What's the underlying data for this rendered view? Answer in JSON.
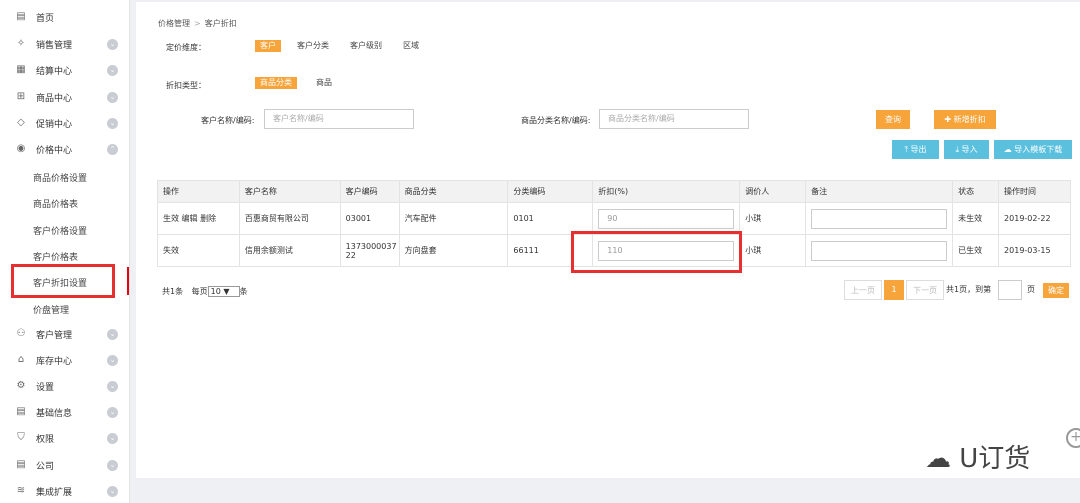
{
  "sidebar": {
    "items": [
      {
        "label": "首页",
        "icon": "doc-icon",
        "has_chevron": false
      },
      {
        "label": "销售管理",
        "icon": "sales-icon",
        "has_chevron": true
      },
      {
        "label": "结算中心",
        "icon": "settle-icon",
        "has_chevron": true
      },
      {
        "label": "商品中心",
        "icon": "grid-icon",
        "has_chevron": true
      },
      {
        "label": "促销中心",
        "icon": "tag-icon",
        "has_chevron": true
      },
      {
        "label": "价格中心",
        "icon": "price-icon",
        "has_chevron": true
      }
    ],
    "sub_items": [
      "商品价格设置",
      "商品价格表",
      "客户价格设置",
      "客户价格表",
      "客户折扣设置",
      "价盘管理"
    ],
    "lower_items": [
      {
        "label": "客户管理",
        "icon": "users-icon"
      },
      {
        "label": "库存中心",
        "icon": "warehouse-icon"
      },
      {
        "label": "设置",
        "icon": "gear-icon"
      },
      {
        "label": "基础信息",
        "icon": "info-icon"
      },
      {
        "label": "权限",
        "icon": "shield-icon"
      },
      {
        "label": "公司",
        "icon": "company-icon"
      },
      {
        "label": "集成扩展",
        "icon": "layers-icon"
      }
    ]
  },
  "breadcrumb": {
    "root": "价格管理",
    "sep": ">",
    "current": "客户折扣"
  },
  "filters": {
    "pricing_label": "定价维度：",
    "pricing_options": [
      "客户",
      "客户分类",
      "客户级别",
      "区域"
    ],
    "discount_label": "折扣类型：",
    "discount_options": [
      "商品分类",
      "商品"
    ],
    "customer_label": "客户名称/编码:",
    "customer_placeholder": "客户名称/编码",
    "category_label": "商品分类名称/编码:",
    "category_placeholder": "商品分类名称/编码"
  },
  "buttons": {
    "query": "查询",
    "add": "新增折扣",
    "export": "导出",
    "import": "导入",
    "template": "导入模板下载"
  },
  "table": {
    "headers": [
      "操作",
      "客户名称",
      "客户编码",
      "商品分类",
      "分类编码",
      "折扣(%)",
      "调价人",
      "备注",
      "状态",
      "操作时间"
    ],
    "rows": [
      {
        "actions": "生效 编辑 删除",
        "customer": "百惠商贸有限公司",
        "code": "03001",
        "category": "汽车配件",
        "cat_code": "0101",
        "discount": "90",
        "adjuster": "小琪",
        "remark": "",
        "status": "未生效",
        "time": "2019-02-22"
      },
      {
        "actions": "失效",
        "customer": "信用余额测试",
        "code": "1373000037 22",
        "category": "方向盘套",
        "cat_code": "66111",
        "discount": "110",
        "adjuster": "小琪",
        "remark": "",
        "status": "已生效",
        "time": "2019-03-15"
      }
    ]
  },
  "footer": {
    "total": "共1条",
    "per_page_label": "每页",
    "per_page": "10 ▼",
    "unit": "条"
  },
  "pagination": {
    "prev": "上一页",
    "current": "1",
    "next": "下一页",
    "pages": "共1页，到第",
    "page_unit": "页",
    "confirm": "确定"
  },
  "watermark": "U订货",
  "colors": {
    "accent": "#f7a43a",
    "blue": "#5bc0de",
    "highlight": "#e63030"
  }
}
